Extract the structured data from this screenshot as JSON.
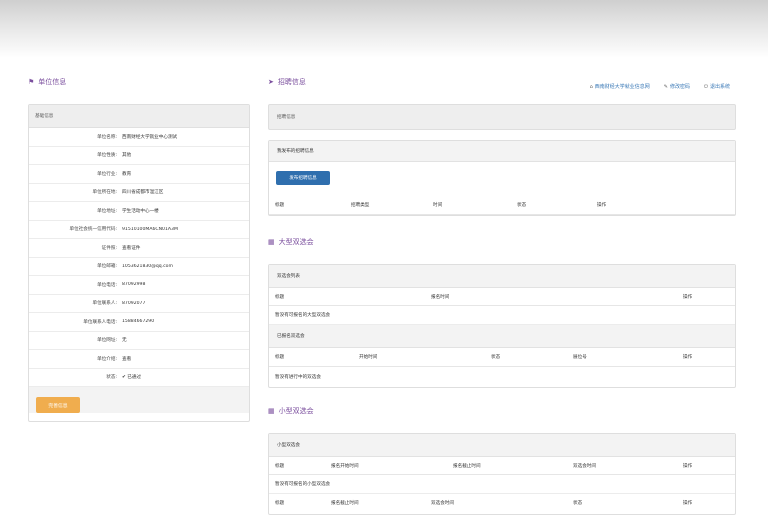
{
  "unit": {
    "section_title": "单位信息",
    "panel_header": "基础信息",
    "fields": [
      {
        "label": "单位名称:",
        "value": "西南财经大学就业中心测试"
      },
      {
        "label": "单位性质:",
        "value": "其他"
      },
      {
        "label": "单位行业:",
        "value": "教育"
      },
      {
        "label": "单位所在地:",
        "value": "四川省成都市温江区"
      },
      {
        "label": "单位地址:",
        "value": "学生活动中心一楼"
      },
      {
        "label": "单位社会统一信用代码:",
        "value": "91510100MA6CN01A3M"
      },
      {
        "label": "证件照:",
        "value": "查看证件"
      },
      {
        "label": "单位邮箱:",
        "value": "1053621830@qq.com"
      },
      {
        "label": "单位电话:",
        "value": "87092998"
      },
      {
        "label": "单位联系人:",
        "value": "87092077"
      },
      {
        "label": "单位联系人电话:",
        "value": "15884667290"
      },
      {
        "label": "单位网址:",
        "value": "无"
      },
      {
        "label": "单位介绍:",
        "value": "查看"
      },
      {
        "label": "状态:",
        "value": "✔ 已通过"
      }
    ],
    "edit_button": "完善信息"
  },
  "top_links": [
    {
      "icon": "home-icon",
      "glyph": "⌂",
      "label": "西南财经大学就业信息网"
    },
    {
      "icon": "key-icon",
      "glyph": "✎",
      "label": "修改密码"
    },
    {
      "icon": "power-icon",
      "glyph": "⏻",
      "label": "退出系统"
    }
  ],
  "recruit": {
    "section_title": "招聘信息",
    "panel_header": "招聘信息",
    "sub_header": "我发布的招聘信息",
    "publish_button": "发布招聘信息",
    "columns": [
      "标题",
      "招聘类型",
      "时间",
      "状态",
      "操作"
    ]
  },
  "large_fair": {
    "section_title": "大型双选会",
    "sub1": "双选会列表",
    "columns1": [
      "标题",
      "报名时间",
      "操作"
    ],
    "empty1": "暂没有可报名的大型双选会",
    "sub2": "已报名双选会",
    "columns2": [
      "标题",
      "开始时间",
      "状态",
      "展位号",
      "操作"
    ],
    "empty2": "暂没有进行中的双选会"
  },
  "small_fair": {
    "section_title": "小型双选会",
    "sub1": "小型双选会",
    "columns1": [
      "标题",
      "报名开始时间",
      "报名截止时间",
      "双选会时间",
      "操作"
    ],
    "empty1": "暂没有可报名的小型双选会",
    "columns2": [
      "标题",
      "报名截止时间",
      "双选会时间",
      "状态",
      "操作"
    ]
  },
  "colors": {
    "accent": "#7b4f9e",
    "link": "#3a79b7",
    "warning": "#f0ad4e",
    "primary": "#2f6fae"
  }
}
